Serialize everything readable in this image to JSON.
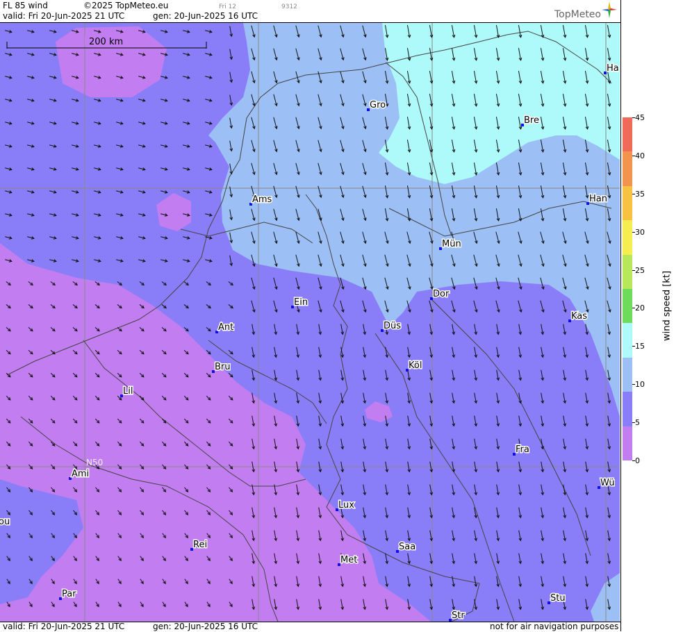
{
  "header": {
    "title": "FL 85 wind",
    "copyright": "©2025 TopMeteo.eu",
    "small_day": "Fri 12",
    "small_code": "9312",
    "valid": "valid:  Fri  20-Jun-2025  21 UTC",
    "gen": "gen: 20-Jun-2025 16 UTC",
    "logo": "TopMeteo"
  },
  "footer": {
    "valid": "valid:  Fri  20-Jun-2025  21 UTC",
    "gen": "gen: 20-Jun-2025 16 UTC",
    "disclaimer": "not for air navigation purposes"
  },
  "map": {
    "scale_label": "200 km",
    "latitude_label": "N50",
    "cities": [
      {
        "name": "Ha"
      },
      {
        "name": "Gro"
      },
      {
        "name": "Bre"
      },
      {
        "name": "Ams"
      },
      {
        "name": "Han"
      },
      {
        "name": "Mün"
      },
      {
        "name": "Ein"
      },
      {
        "name": "Dor"
      },
      {
        "name": "Ant"
      },
      {
        "name": "Düs"
      },
      {
        "name": "Kas"
      },
      {
        "name": "Bru"
      },
      {
        "name": "Köl"
      },
      {
        "name": "Lil"
      },
      {
        "name": "Fra"
      },
      {
        "name": "Ami"
      },
      {
        "name": "Wü"
      },
      {
        "name": "Lux"
      },
      {
        "name": "ou"
      },
      {
        "name": "Rei"
      },
      {
        "name": "Saa"
      },
      {
        "name": "Met"
      },
      {
        "name": "Stu"
      },
      {
        "name": "Par"
      },
      {
        "name": "Str"
      }
    ],
    "zone_colors": {
      "0-5": "#c27ef0",
      "5-10": "#8a7ef8",
      "10-15": "#9cbff5",
      "15-20": "#aefafa"
    }
  },
  "legend": {
    "title": "wind speed [kt]",
    "ticks": [
      "45",
      "40",
      "35",
      "30",
      "25",
      "20",
      "15",
      "10",
      "5",
      "0"
    ],
    "colors": [
      "#f06a5a",
      "#f2944e",
      "#f7c242",
      "#f5ee4e",
      "#b7e85a",
      "#6fdb5a",
      "#aefafa",
      "#9cbff5",
      "#8a7ef8",
      "#c27ef0"
    ]
  }
}
